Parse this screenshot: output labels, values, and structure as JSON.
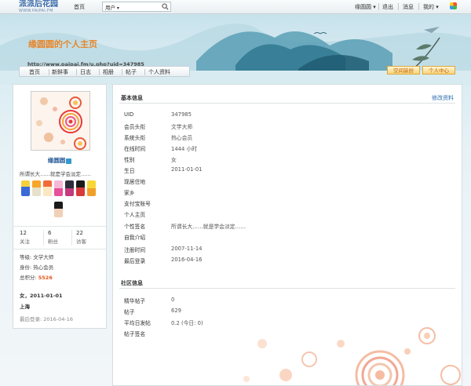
{
  "topbar": {
    "logo_cn": "派派后花园",
    "logo_en": "WWW.PAIPAI.FM",
    "home": "首页",
    "search_type": "用户",
    "username": "缘圆圆",
    "logout": "退出",
    "messages": "消息",
    "mine": "我的"
  },
  "banner": {
    "title": "缘圆圆的个人主页",
    "url": "http://www.paipai.fm/u.php?uid=347985"
  },
  "nav": {
    "items": [
      "首页",
      "新鲜事",
      "日志",
      "相册",
      "帖子",
      "个人资料"
    ],
    "space_button": "空间装扮",
    "center_button": "个人中心"
  },
  "profile": {
    "name": "缘圆圆",
    "signature": "所谓长大……就是学会淡定……",
    "stats": [
      {
        "num": "12",
        "label": "关注"
      },
      {
        "num": "6",
        "label": "粉丝"
      },
      {
        "num": "22",
        "label": "访客"
      }
    ],
    "level": "等级: 文学大师",
    "identity": "身份: 热心会员",
    "points_label": "总积分: ",
    "points_value": "5526",
    "gender_birthday": "女，2011-01-01",
    "location": "上海",
    "last_login": "最后登录: 2016-04-16"
  },
  "basic_info": {
    "title": "基本信息",
    "edit": "修改资料",
    "rows": [
      {
        "label": "UID",
        "value": "347985"
      },
      {
        "label": "会员头衔",
        "value": "文学大师"
      },
      {
        "label": "系统头衔",
        "value": "热心会员"
      },
      {
        "label": "在线时间",
        "value": "1444 小时"
      },
      {
        "label": "性别",
        "value": "女"
      },
      {
        "label": "生日",
        "value": "2011-01-01"
      },
      {
        "label": "现居住地",
        "value": ""
      },
      {
        "label": "家乡",
        "value": ""
      },
      {
        "label": "支付宝账号",
        "value": ""
      },
      {
        "label": "个人主页",
        "value": ""
      },
      {
        "label": "个性签名",
        "value": "所谓长大……就是学会淡定……"
      },
      {
        "label": "自我介绍",
        "value": ""
      },
      {
        "label": "注册时间",
        "value": "2007-11-14"
      },
      {
        "label": "最后登录",
        "value": "2016-04-16"
      }
    ]
  },
  "community_info": {
    "title": "社区信息",
    "rows": [
      {
        "label": "精华帖子",
        "value": "0"
      },
      {
        "label": "帖子",
        "value": "629"
      },
      {
        "label": "平均日发帖",
        "value": "0.2 (今日: 0)"
      },
      {
        "label": "帖子签名",
        "value": ""
      }
    ]
  },
  "colors": {
    "accent_orange": "#e8862a",
    "link_blue": "#2a6ab0",
    "points_orange": "#e8571a"
  }
}
